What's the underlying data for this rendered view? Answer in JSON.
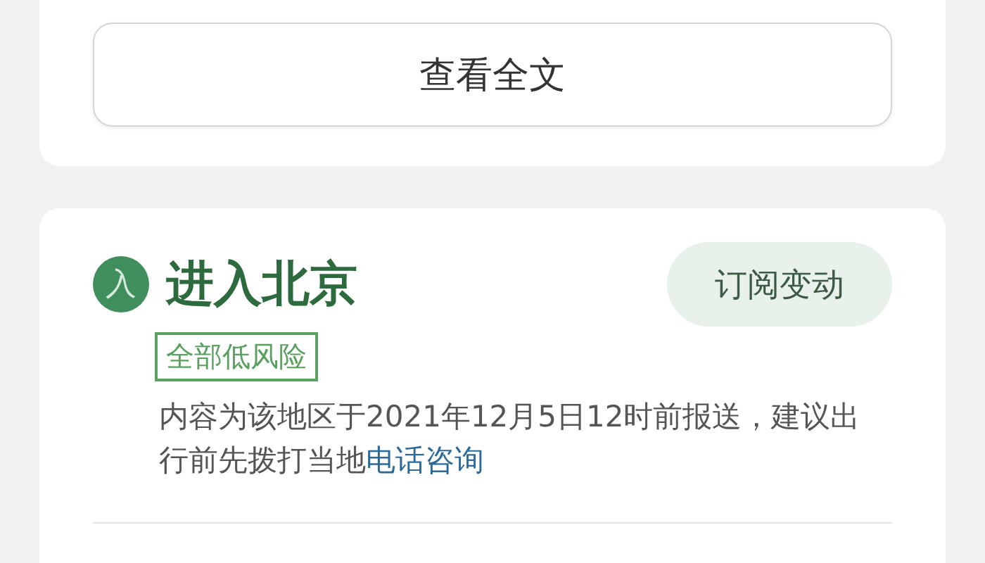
{
  "top_card": {
    "button": "查看全文"
  },
  "entry": {
    "icon_char": "入",
    "title": "进入北京",
    "subscribe": "订阅变动",
    "risk_tag": "全部低风险",
    "notice": "内容为该地区于2021年12月5日12时前报送，建议出行前先拨打当地",
    "notice_link": "电话咨询"
  }
}
